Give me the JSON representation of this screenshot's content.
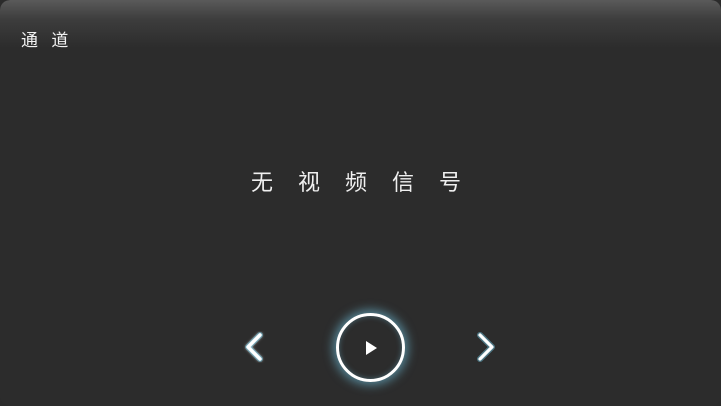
{
  "header": {
    "channel_label": "通 道"
  },
  "main": {
    "status_text": "无 视 频 信 号"
  },
  "controls": {
    "prev_icon": "chevron-left-icon",
    "play_icon": "play-icon",
    "next_icon": "chevron-right-icon"
  },
  "colors": {
    "background": "#2c2c2c",
    "text": "#f0f0f0",
    "glow": "#78d2f0"
  }
}
